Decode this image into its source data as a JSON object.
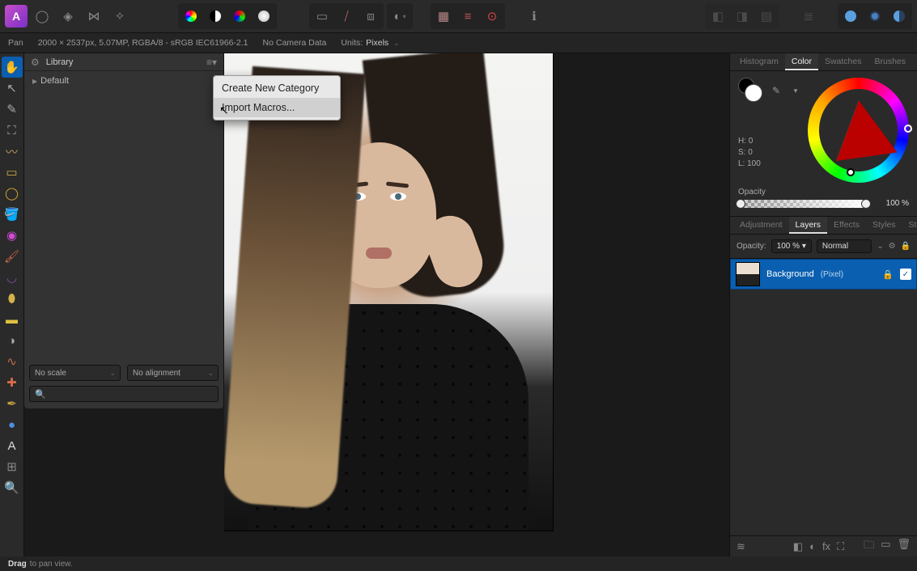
{
  "topbar": {
    "app_glyph": "A"
  },
  "contextbar": {
    "tool": "Pan",
    "doc_info": "2000 × 2537px, 5.07MP, RGBA/8 - sRGB IEC61966-2.1",
    "camera": "No Camera Data",
    "units_label": "Units:",
    "units_value": "Pixels"
  },
  "library": {
    "title": "Library",
    "default_item": "Default",
    "scale_sel": "No scale",
    "align_sel": "No alignment",
    "search_placeholder": ""
  },
  "ctxmenu": {
    "item1": "Create New Category",
    "item2": "Import Macros..."
  },
  "color_tabs": {
    "histogram": "Histogram",
    "color": "Color",
    "swatches": "Swatches",
    "brushes": "Brushes"
  },
  "color": {
    "h_label": "H:",
    "h_val": "0",
    "s_label": "S:",
    "s_val": "0",
    "l_label": "L:",
    "l_val": "100",
    "opacity_label": "Opacity",
    "opacity_val": "100 %"
  },
  "layer_tabs": {
    "adjustment": "Adjustment",
    "layers": "Layers",
    "effects": "Effects",
    "styles": "Styles",
    "stock": "Stock"
  },
  "layers": {
    "opacity_label": "Opacity:",
    "opacity_val": "100 %",
    "blend": "Normal",
    "bg_name": "Background",
    "bg_type": "(Pixel)"
  },
  "status": {
    "verb": "Drag",
    "rest": "to pan view."
  }
}
